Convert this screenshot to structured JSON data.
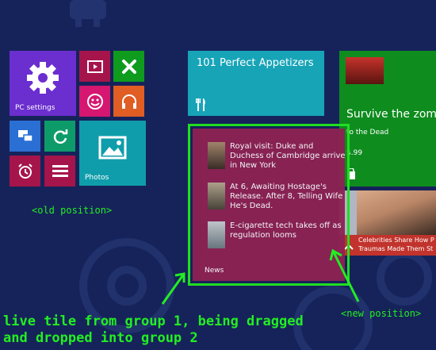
{
  "tiles": {
    "pc_settings": "PC settings",
    "photos": "Photos",
    "appetizers": "101 Perfect Appetizers",
    "game_title": "Survive the zomb",
    "game_sub": "to the Dead",
    "game_price": "$.99",
    "news_label": "News",
    "celeb_line1": "Celebrities Share How P",
    "celeb_line2": "Traumas Made Them St"
  },
  "news": {
    "items": [
      {
        "text": "Royal visit: Duke and Duchess of Cambridge arrive in New York"
      },
      {
        "text": "At 6, Awaiting Hostage's Release. After 8, Telling Wife He's Dead."
      },
      {
        "text": "E-cigarette tech takes off as regulation looms"
      }
    ]
  },
  "annotations": {
    "old_position": "<old position>",
    "new_position": "<new position>",
    "caption_line1": "live tile from group 1, being dragged",
    "caption_line2": "and dropped into group 2"
  },
  "colors": {
    "background": "#16235a",
    "annotation": "#22ee22",
    "tile_purple": "#6b2ecf",
    "tile_crimson": "#a5154b",
    "tile_green": "#0e9b1e",
    "tile_blue": "#2a6fd4",
    "tile_teal": "#0f9dab",
    "tile_magenta": "#d51771",
    "tile_orange": "#e05d23",
    "news_tile": "#8e2253"
  }
}
